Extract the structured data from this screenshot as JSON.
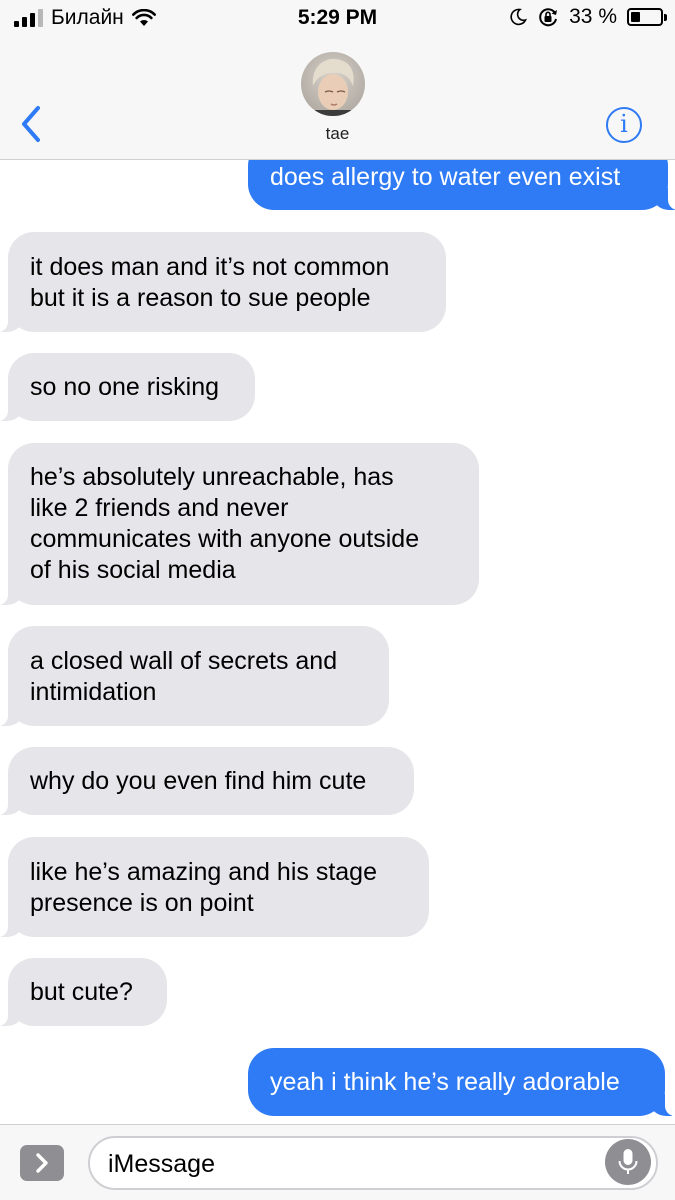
{
  "status_bar": {
    "carrier": "Билайн",
    "time": "5:29 PM",
    "battery_percent": "33 %",
    "battery_level": 0.33,
    "signal_bars_active": 3,
    "signal_bars_total": 4
  },
  "nav": {
    "contact_name": "tae",
    "info_label": "i"
  },
  "messages": [
    {
      "direction": "outgoing",
      "lines": [
        "does allergy to water even exist"
      ]
    },
    {
      "direction": "incoming",
      "lines": [
        "it does man and it’s not common",
        "but it is a reason to sue people"
      ]
    },
    {
      "direction": "incoming",
      "lines": [
        "so no one risking"
      ]
    },
    {
      "direction": "incoming",
      "lines": [
        "he’s absolutely unreachable, has",
        "like 2 friends and never",
        "communicates with anyone outside",
        "of his social media"
      ]
    },
    {
      "direction": "incoming",
      "lines": [
        "a closed wall of secrets and",
        "intimidation"
      ]
    },
    {
      "direction": "incoming",
      "lines": [
        "why do you even find him cute"
      ]
    },
    {
      "direction": "incoming",
      "lines": [
        "like he’s amazing and his stage",
        "presence is on point"
      ]
    },
    {
      "direction": "incoming",
      "lines": [
        "but cute?"
      ]
    },
    {
      "direction": "outgoing",
      "lines": [
        "yeah i think he’s really adorable"
      ]
    }
  ],
  "compose": {
    "placeholder": "iMessage"
  },
  "colors": {
    "accent_blue": "#2f7bf5",
    "incoming_bubble": "#e5e5ea",
    "header_bg": "#f7f7f7"
  },
  "icons": {
    "back": "chevron-left-icon",
    "info": "info-icon",
    "apps": "chevron-right-icon",
    "mic": "microphone-icon",
    "wifi": "wifi-icon",
    "moon": "moon-icon",
    "rotation_lock": "rotation-lock-icon"
  }
}
